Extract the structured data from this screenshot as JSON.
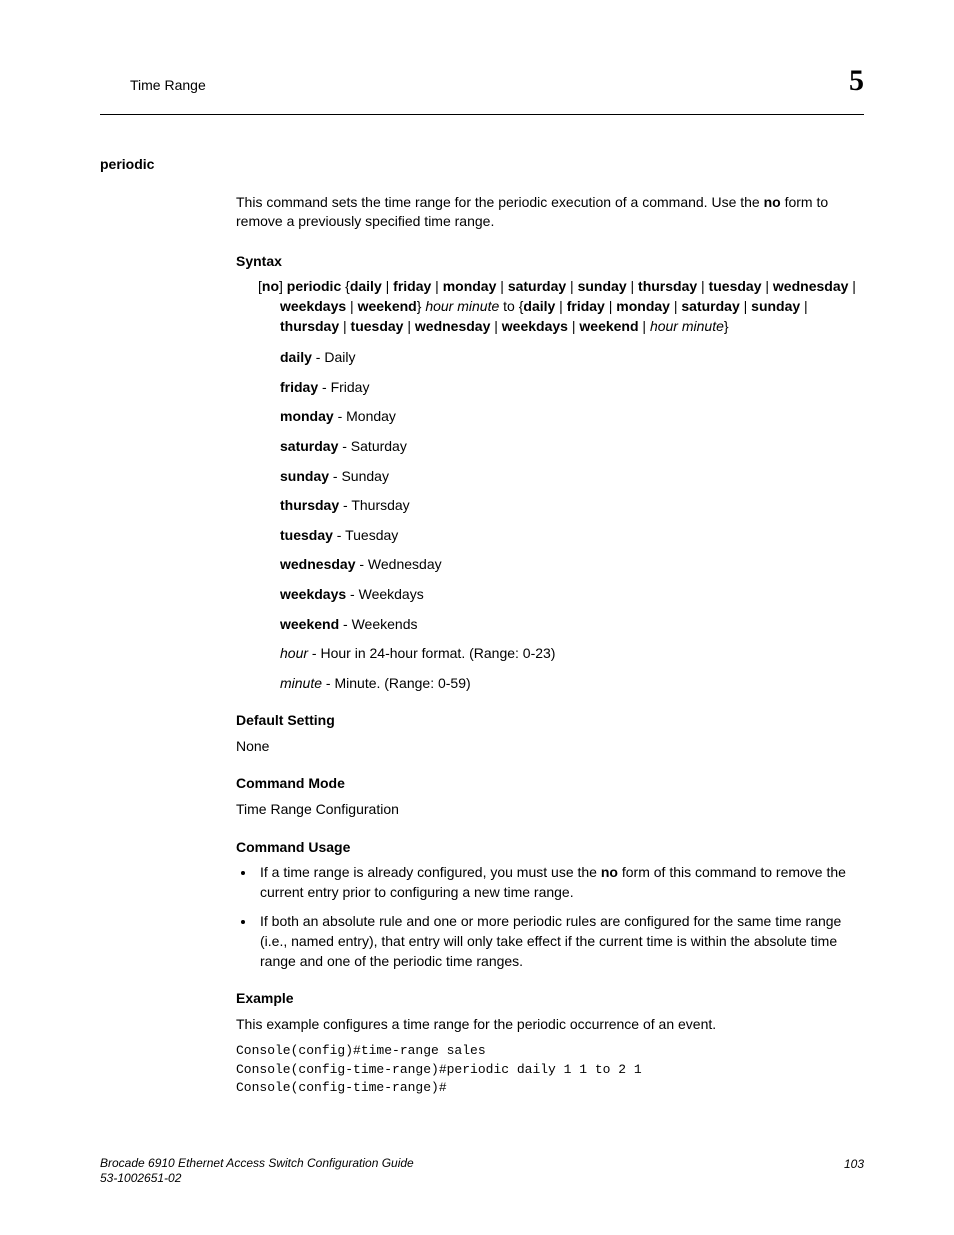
{
  "header": {
    "section": "Time Range",
    "chapter": "5"
  },
  "command": "periodic",
  "description_pre": "This command sets the time range for the periodic execution of a command. Use the ",
  "description_bold": "no",
  "description_post": " form to remove a previously specified time range.",
  "syntax": {
    "title": "Syntax",
    "parts": {
      "p1": "[",
      "p2": "no",
      "p3": "] ",
      "p4": "periodic",
      "p5": " {",
      "p6": "daily",
      "p7": " | ",
      "p8": "friday",
      "p9": " | ",
      "p10": "monday",
      "p11": " | ",
      "p12": "saturday",
      "p13": " | ",
      "p14": "sunday",
      "p15": " | ",
      "p16": "thursday",
      "p17": " | ",
      "p18": "tuesday",
      "p19": " | ",
      "p20": "wednesday",
      "p21": " | ",
      "p22": "weekdays",
      "p23": " | ",
      "p24": "weekend",
      "p25": "} ",
      "p26": "hour minute",
      "p27": " to {",
      "p28": "daily",
      "p29": " | ",
      "p30": "friday",
      "p31": " | ",
      "p32": "monday",
      "p33": " | ",
      "p34": "saturday",
      "p35": " | ",
      "p36": "sunday",
      "p37": " | ",
      "p38": "thursday",
      "p39": " | ",
      "p40": "tuesday",
      "p41": " | ",
      "p42": "wednesday",
      "p43": " | ",
      "p44": "weekdays",
      "p45": " | ",
      "p46": "weekend",
      "p47": " | ",
      "p48": "hour minute",
      "p49": "}"
    }
  },
  "params": [
    {
      "term": "daily",
      "desc": " - Daily",
      "italic": false
    },
    {
      "term": "friday",
      "desc": " - Friday",
      "italic": false
    },
    {
      "term": "monday",
      "desc": " - Monday",
      "italic": false
    },
    {
      "term": "saturday",
      "desc": " - Saturday",
      "italic": false
    },
    {
      "term": "sunday",
      "desc": " - Sunday",
      "italic": false
    },
    {
      "term": "thursday",
      "desc": " - Thursday",
      "italic": false
    },
    {
      "term": "tuesday",
      "desc": " - Tuesday",
      "italic": false
    },
    {
      "term": "wednesday",
      "desc": " - Wednesday",
      "italic": false
    },
    {
      "term": "weekdays",
      "desc": " - Weekdays",
      "italic": false
    },
    {
      "term": "weekend",
      "desc": " - Weekends",
      "italic": false
    },
    {
      "term": "hour",
      "desc": " - Hour in 24-hour format. (Range: 0-23)",
      "italic": true
    },
    {
      "term": "minute",
      "desc": " - Minute. (Range: 0-59)",
      "italic": true
    }
  ],
  "default_setting": {
    "title": "Default Setting",
    "value": "None"
  },
  "command_mode": {
    "title": "Command Mode",
    "value": "Time Range Configuration"
  },
  "command_usage": {
    "title": "Command Usage",
    "items": [
      {
        "pre": "If a time range is already configured, you must use the ",
        "bold": "no",
        "post": " form of this command to remove the current entry prior to configuring a new time range."
      },
      {
        "pre": "If both an absolute rule and one or more periodic rules are configured for the same time range (i.e., named entry), that entry will only take effect if the current time is within the absolute time range and one of the periodic time ranges.",
        "bold": "",
        "post": ""
      }
    ]
  },
  "example": {
    "title": "Example",
    "intro": "This example configures a time range for the periodic occurrence of an event.",
    "code": "Console(config)#time-range sales\nConsole(config-time-range)#periodic daily 1 1 to 2 1\nConsole(config-time-range)#"
  },
  "footer": {
    "line1": "Brocade 6910 Ethernet Access Switch Configuration Guide",
    "line2": "53-1002651-02",
    "page": "103"
  }
}
